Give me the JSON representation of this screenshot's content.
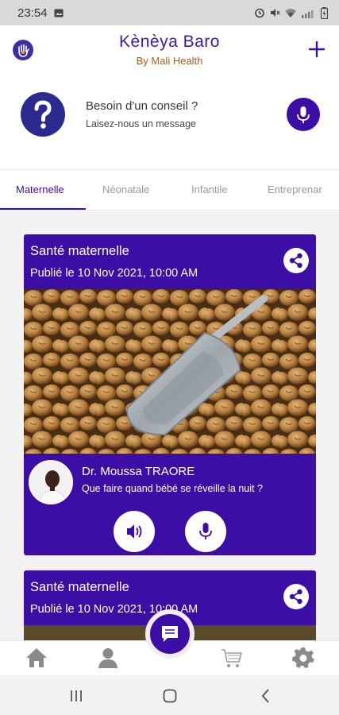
{
  "status_bar": {
    "time": "23:54",
    "icons": [
      "image-icon",
      "alarm-icon",
      "mute-icon",
      "wifi-icon",
      "signal-icon",
      "battery-icon"
    ]
  },
  "header": {
    "title": "Kènèya Baro",
    "subtitle": "By Mali Health",
    "logo_icon": "hand-logo-icon",
    "action_icon": "plus-icon"
  },
  "advice": {
    "title": "Besoin d'un conseil ?",
    "subtitle": "Laisez-nous un message",
    "help_icon": "question-icon",
    "record_icon": "microphone-icon"
  },
  "tabs": [
    {
      "label": "Maternelle",
      "active": true
    },
    {
      "label": "Néonatale",
      "active": false
    },
    {
      "label": "Infantile",
      "active": false
    },
    {
      "label": "Entreprenar",
      "active": false
    }
  ],
  "posts": [
    {
      "category": "Santé maternelle",
      "published": "Publié le 10 Nov 2021, 10:00 AM",
      "author": "Dr. Moussa TRAORE",
      "question": "Que faire quand bébé se réveille la nuit ?",
      "share_icon": "share-icon",
      "listen_icon": "speaker-icon",
      "reply_icon": "microphone-icon"
    },
    {
      "category": "Santé maternelle",
      "published": "Publié le 10 Nov 2021, 10:00 AM",
      "share_icon": "share-icon"
    }
  ],
  "bottom_nav": [
    "home-icon",
    "profile-icon",
    "chat-icon",
    "cart-icon",
    "settings-icon"
  ],
  "colors": {
    "primary": "#3c0ea6",
    "title": "#3d1aa7",
    "subtitle": "#b05a1a",
    "status_bar": "#d9d9d9"
  }
}
